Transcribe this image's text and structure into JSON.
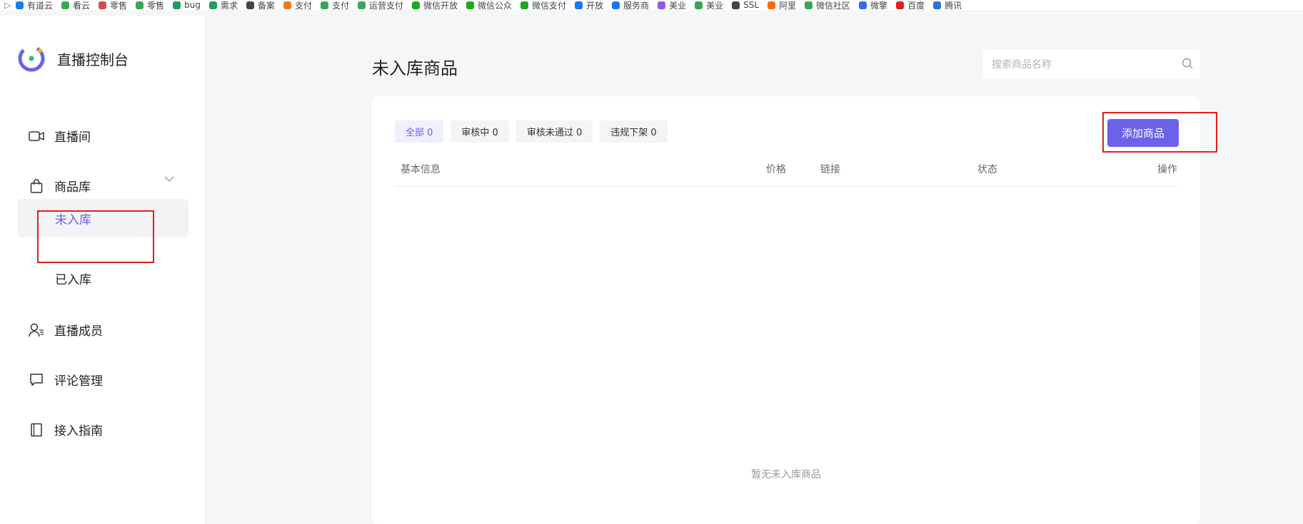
{
  "bookmarks": [
    {
      "label": "有道云",
      "color": "#1e7ce5"
    },
    {
      "label": "看云",
      "color": "#3aa655"
    },
    {
      "label": "零售",
      "color": "#d54a4a"
    },
    {
      "label": "零售",
      "color": "#3aa655"
    },
    {
      "label": "bug",
      "color": "#1f9d5a"
    },
    {
      "label": "需求",
      "color": "#1f9d5a"
    },
    {
      "label": "备案",
      "color": "#444444"
    },
    {
      "label": "支付",
      "color": "#f07b1f"
    },
    {
      "label": "支付",
      "color": "#3aa655"
    },
    {
      "label": "运营支付",
      "color": "#3aa655"
    },
    {
      "label": "微信开放",
      "color": "#1aad19"
    },
    {
      "label": "微信公众",
      "color": "#1aad19"
    },
    {
      "label": "微信支付",
      "color": "#1aad19"
    },
    {
      "label": "开放",
      "color": "#1677ff"
    },
    {
      "label": "服务商",
      "color": "#1677ff"
    },
    {
      "label": "美业",
      "color": "#8a5cf5"
    },
    {
      "label": "美业",
      "color": "#3aa655"
    },
    {
      "label": "SSL",
      "color": "#444444"
    },
    {
      "label": "阿里",
      "color": "#ff6a00"
    },
    {
      "label": "微信社区",
      "color": "#3aa655"
    },
    {
      "label": "微擎",
      "color": "#2f6fe5"
    },
    {
      "label": "百度",
      "color": "#e0201c"
    },
    {
      "label": "腾讯",
      "color": "#2f6fe5"
    }
  ],
  "brand": {
    "title": "直播控制台",
    "accent": "#6a62e8"
  },
  "nav": {
    "live_room": "直播间",
    "product_library": "商品库",
    "not_stocked": "未入库",
    "stocked": "已入库",
    "members": "直播成员",
    "comments": "评论管理",
    "guide": "接入指南"
  },
  "main": {
    "title": "未入库商品",
    "search_placeholder": "搜索商品名称",
    "tabs": [
      {
        "label": "全部 0",
        "active": true
      },
      {
        "label": "审核中 0",
        "active": false
      },
      {
        "label": "审核未通过 0",
        "active": false
      },
      {
        "label": "违规下架 0",
        "active": false
      }
    ],
    "add_button": "添加商品",
    "columns": {
      "info": "基本信息",
      "price": "价格",
      "link": "链接",
      "status": "状态",
      "actions": "操作"
    },
    "empty_text": "暂无未入库商品"
  }
}
